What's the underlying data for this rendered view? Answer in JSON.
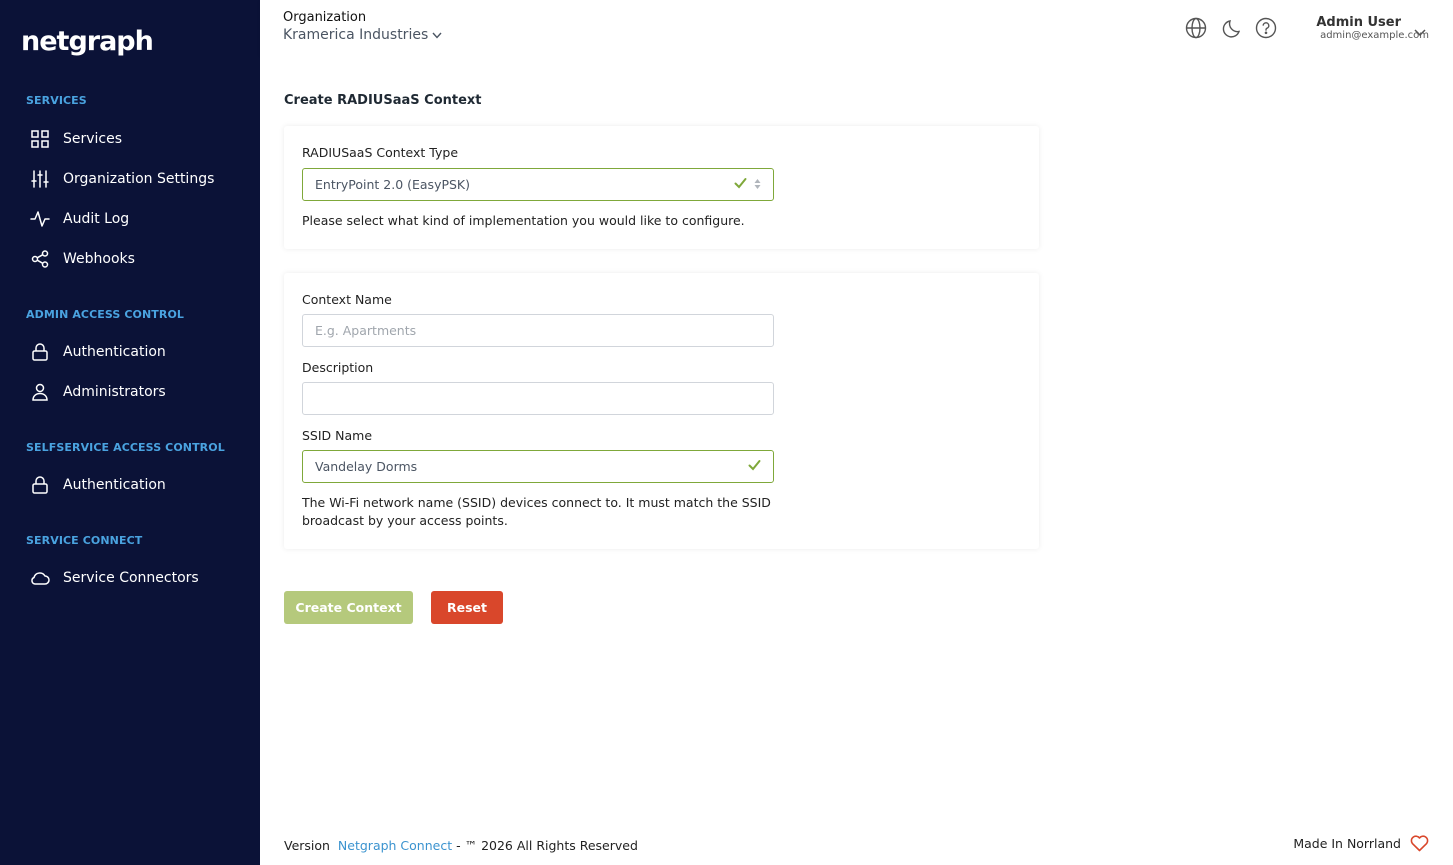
{
  "sidebar": {
    "logo": "netgraph",
    "sections": [
      {
        "title": "SERVICES"
      },
      {
        "title": "ADMIN ACCESS CONTROL"
      },
      {
        "title": "SELFSERVICE ACCESS CONTROL"
      },
      {
        "title": "SERVICE CONNECT"
      }
    ],
    "items": [
      {
        "label": "Services",
        "icon": "grid-icon"
      },
      {
        "label": "Organization Settings",
        "icon": "sliders-icon"
      },
      {
        "label": "Audit Log",
        "icon": "activity-icon"
      },
      {
        "label": "Webhooks",
        "icon": "share-icon"
      },
      {
        "label": "Authentication",
        "icon": "lock-icon"
      },
      {
        "label": "Administrators",
        "icon": "user-icon"
      },
      {
        "label": "Authentication",
        "icon": "lock-icon"
      },
      {
        "label": "Service Connectors",
        "icon": "cloud-icon"
      }
    ]
  },
  "header": {
    "org_label": "Organization",
    "org_value": "Kramerica Industries",
    "user_name": "Admin User",
    "user_email": "admin@example.com"
  },
  "main": {
    "title": "Create RADIUSaaS Context",
    "type_card": {
      "label": "RADIUSaaS Context Type",
      "value": "EntryPoint 2.0 (EasyPSK)",
      "help": "Please select what kind of implementation you would like to configure."
    },
    "form_card": {
      "context_name_label": "Context Name",
      "context_name_placeholder": "E.g. Apartments",
      "context_name_value": "",
      "description_label": "Description",
      "description_value": "",
      "ssid_label": "SSID Name",
      "ssid_value": "Vandelay Dorms",
      "ssid_help": "The Wi-Fi network name (SSID) devices connect to. It must match the SSID broadcast by your access points."
    },
    "buttons": {
      "create": "Create Context",
      "reset": "Reset"
    }
  },
  "footer": {
    "version_label": "Version",
    "link_text": "Netgraph Connect",
    "rights": "- ™ 2026 All Rights Reserved",
    "made_in": "Made In Norrland"
  },
  "colors": {
    "sidebar_bg": "#0b1237",
    "section_title": "#4aa3e0",
    "valid_green": "#7fa83a",
    "create_button": "#b5c97c",
    "reset_button": "#d9472b",
    "link": "#3b93cf",
    "heart": "#d9472b"
  }
}
